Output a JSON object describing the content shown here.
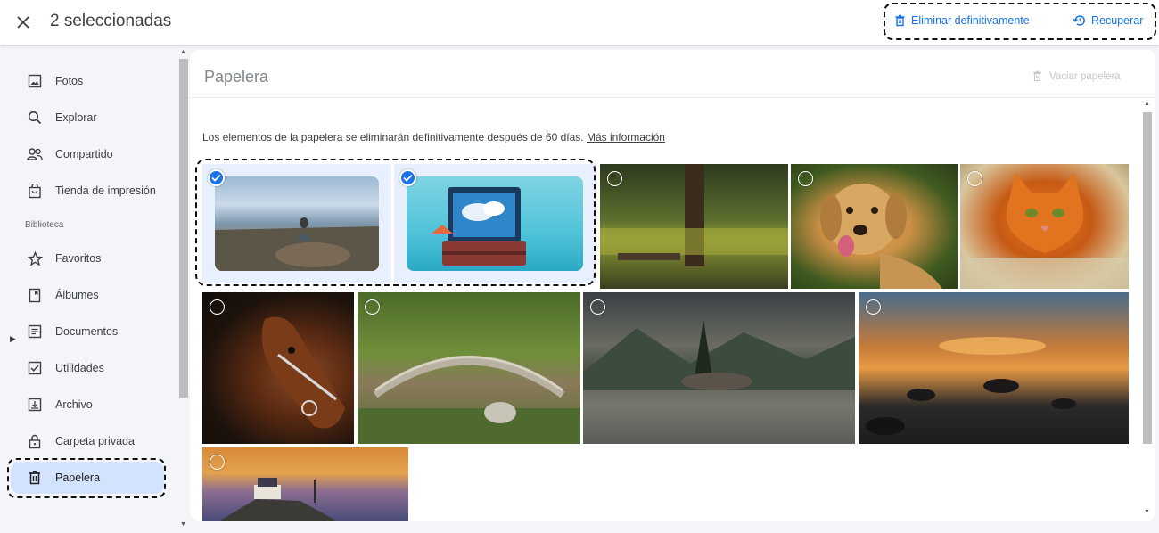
{
  "header": {
    "selection_title": "2 seleccionadas",
    "delete_permanently": "Eliminar definitivamente",
    "recover": "Recuperar"
  },
  "sidebar": {
    "items": [
      {
        "label": "Fotos",
        "icon": "photo-icon"
      },
      {
        "label": "Explorar",
        "icon": "search-icon"
      },
      {
        "label": "Compartido",
        "icon": "people-icon"
      },
      {
        "label": "Tienda de impresión",
        "icon": "shopping-bag-icon"
      }
    ],
    "library_label": "Biblioteca",
    "library_items": [
      {
        "label": "Favoritos",
        "icon": "star-icon"
      },
      {
        "label": "Álbumes",
        "icon": "album-icon"
      },
      {
        "label": "Documentos",
        "icon": "document-icon"
      },
      {
        "label": "Utilidades",
        "icon": "utilities-icon"
      },
      {
        "label": "Archivo",
        "icon": "archive-icon"
      },
      {
        "label": "Carpeta privada",
        "icon": "lock-icon"
      },
      {
        "label": "Papelera",
        "icon": "trash-icon",
        "active": true
      }
    ]
  },
  "main": {
    "title": "Papelera",
    "empty_trash": "Vaciar papelera",
    "info_text": "Los elementos de la papelera se eliminarán definitivamente después de 60 días.",
    "info_link": "Más información"
  },
  "colors": {
    "accent": "#1a73e8",
    "active_nav_bg": "#d3e3fd",
    "selected_photo_bg": "#e8f0fe"
  },
  "photos": [
    {
      "subject": "meditation-by-sea",
      "selected": true
    },
    {
      "subject": "suitcase-with-clouds",
      "selected": true
    },
    {
      "subject": "forest-lake",
      "selected": false
    },
    {
      "subject": "golden-retriever",
      "selected": false
    },
    {
      "subject": "orange-cat",
      "selected": false
    },
    {
      "subject": "brown-horse",
      "selected": false
    },
    {
      "subject": "garden-bridge",
      "selected": false
    },
    {
      "subject": "mountain-lake",
      "selected": false
    },
    {
      "subject": "rocky-sunset-lake",
      "selected": false
    },
    {
      "subject": "lighthouse-at-dusk",
      "selected": false
    }
  ]
}
